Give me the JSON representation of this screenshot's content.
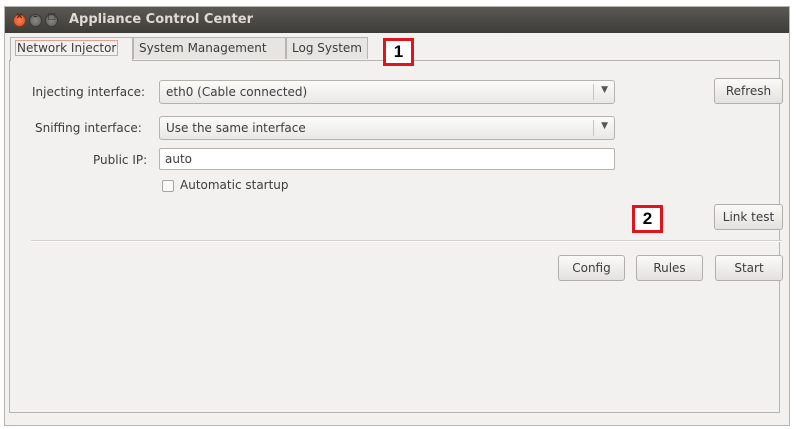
{
  "window": {
    "title": "Appliance Control Center"
  },
  "tabs": [
    {
      "label": "Network Injector",
      "active": true
    },
    {
      "label": "System Management",
      "active": false
    },
    {
      "label": "Log System",
      "active": false
    }
  ],
  "form": {
    "injecting_label": "Injecting interface:",
    "injecting_value": "eth0 (Cable connected)",
    "sniffing_label": "Sniffing interface:",
    "sniffing_value": "Use the same interface",
    "public_ip_label": "Public IP:",
    "public_ip_value": "auto",
    "autostart_label": "Automatic startup",
    "autostart_checked": false
  },
  "buttons": {
    "refresh": "Refresh",
    "link_test": "Link test",
    "config": "Config",
    "rules": "Rules",
    "start": "Start"
  },
  "annotations": {
    "marker_1": "1",
    "marker_2": "2"
  },
  "colors": {
    "titlebar": "#3d3c38",
    "close_button": "#d9501e",
    "marker_border": "#e0141b"
  }
}
